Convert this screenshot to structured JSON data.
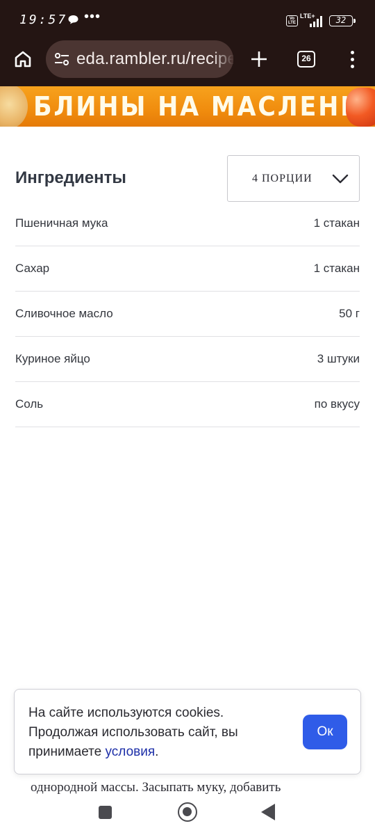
{
  "status_bar": {
    "time": "19:57",
    "dots": "•••",
    "network": "LTE+",
    "volte": "Vo LTE",
    "battery": "32"
  },
  "browser": {
    "url": "eda.rambler.ru/recipes",
    "tab_count": "26"
  },
  "banner": {
    "text": "БЛИНЫ НА МАСЛЕНИЦУ"
  },
  "ingredients": {
    "title": "Ингредиенты",
    "portions": "4 ПОРЦИИ",
    "items": [
      {
        "name": "Пшеничная мука",
        "qty": "1 стакан"
      },
      {
        "name": "Сахар",
        "qty": "1 стакан"
      },
      {
        "name": "Сливочное масло",
        "qty": "50 г"
      },
      {
        "name": "Куриное яйцо",
        "qty": "3 штуки"
      },
      {
        "name": "Соль",
        "qty": "по вкусу"
      }
    ]
  },
  "background_text": {
    "line1": "однородной массы. Засыпать муку, добавить"
  },
  "cookie": {
    "text_before": "На сайте используются cookies. Продолжая использовать сайт, вы принимаете ",
    "link": "условия",
    "text_after": ".",
    "ok": "Ок"
  }
}
